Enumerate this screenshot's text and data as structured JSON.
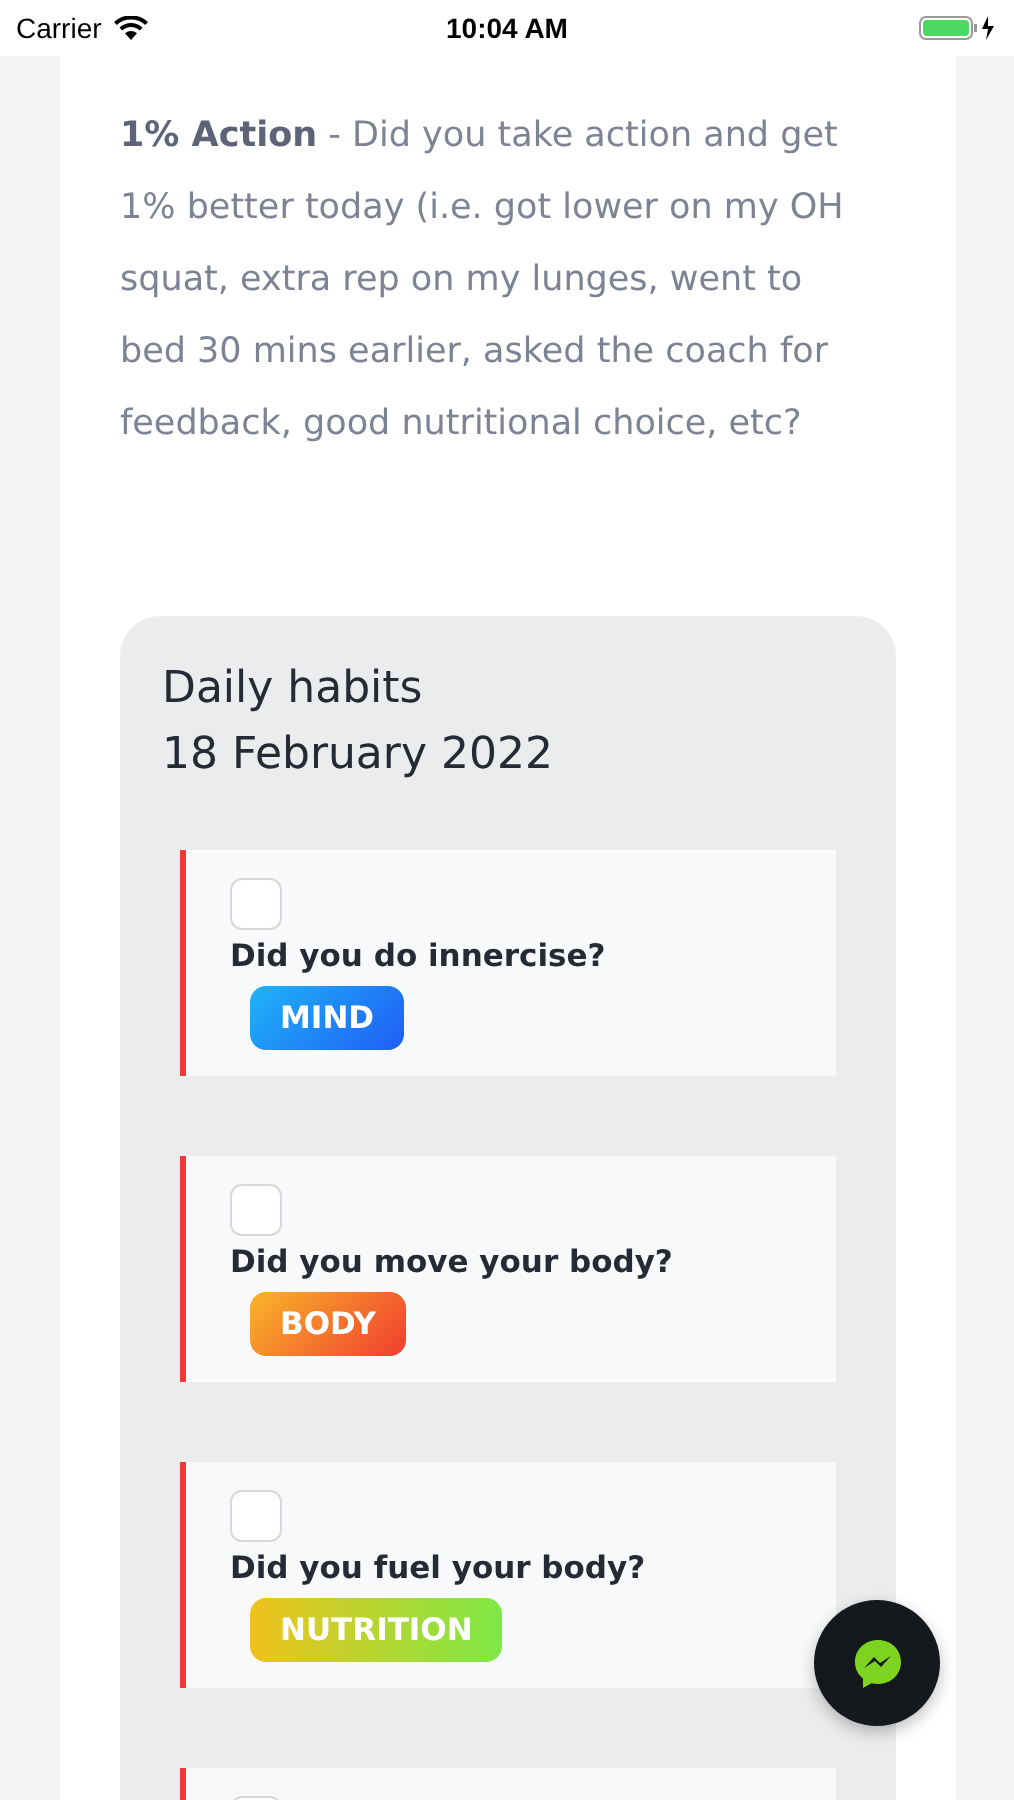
{
  "status_bar": {
    "carrier": "Carrier",
    "time": "10:04 AM"
  },
  "intro": "**1% Action** - Did you take action and get 1% better today (i.e. got lower on my OH squat, extra rep on my lunges, went to bed 30 mins earlier, asked the coach for feedback, good nutritional choice, etc?",
  "habits_card": {
    "title": "Daily habits",
    "date": "18 February 2022",
    "habits": [
      {
        "question": "Did you do innercise?",
        "checked": false,
        "tag": {
          "label": "MIND",
          "kind": "mind"
        }
      },
      {
        "question": "Did you move your body?",
        "checked": false,
        "tag": {
          "label": "BODY",
          "kind": "body"
        }
      },
      {
        "question": "Did you fuel your body?",
        "checked": false,
        "tag": {
          "label": "NUTRITION",
          "kind": "nutrition"
        }
      },
      {
        "checked": false
      }
    ]
  }
}
